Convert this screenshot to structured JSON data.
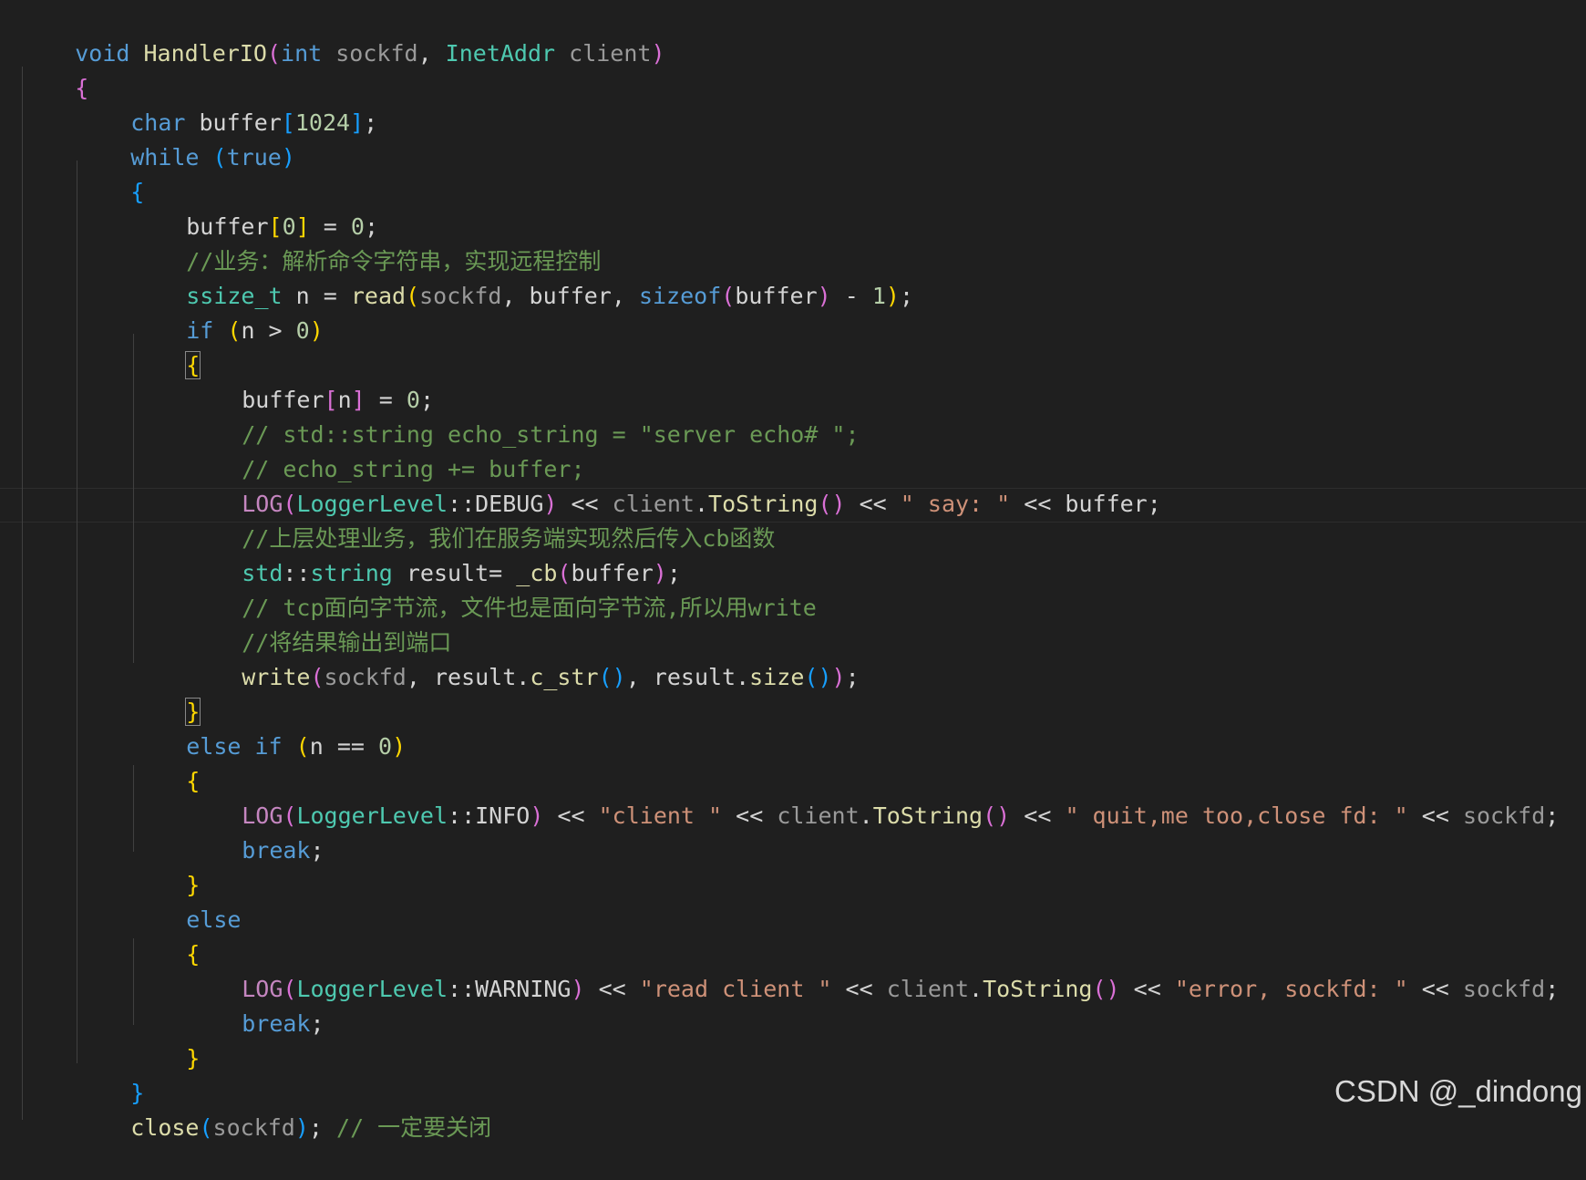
{
  "editor": {
    "line_1": [
      "void",
      " ",
      "HandlerIO",
      "(",
      "int",
      " ",
      "sockfd",
      ", ",
      "InetAddr",
      " ",
      "client",
      ")"
    ],
    "line_2": [
      "{"
    ],
    "line_3": [
      "char",
      " buffer",
      "[",
      "1024",
      "]",
      ";"
    ],
    "line_4": [
      "while",
      " ",
      "(",
      "true",
      ")"
    ],
    "line_5": [
      "{"
    ],
    "line_6": [
      "buffer",
      "[",
      "0",
      "]",
      " = ",
      "0",
      ";"
    ],
    "line_7": [
      "//业务：解析命令字符串，实现远程控制"
    ],
    "line_8": [
      "ssize_t",
      " n = ",
      "read",
      "(",
      "sockfd",
      ", buffer, ",
      "sizeof",
      "(",
      "buffer",
      ")",
      " - ",
      "1",
      ")",
      ";"
    ],
    "line_9": [
      "if",
      " ",
      "(",
      "n > ",
      "0",
      ")"
    ],
    "line_10": [
      "{"
    ],
    "line_11": [
      "buffer",
      "[",
      "n",
      "]",
      " = ",
      "0",
      ";"
    ],
    "line_12": [
      "// std::string echo_string = \"server echo# \";"
    ],
    "line_13": [
      "// echo_string += buffer;"
    ],
    "line_14": [
      "LOG",
      "(",
      "LoggerLevel",
      "::",
      "DEBUG",
      ")",
      " << ",
      "client",
      ".",
      "ToString",
      "()",
      " << ",
      "\" say: \"",
      " << buffer;"
    ],
    "line_15": [
      "//上层处理业务，我们在服务端实现然后传入cb函数"
    ],
    "line_16": [
      "std",
      "::",
      "string",
      " result= ",
      "_cb",
      "(",
      "buffer",
      ")",
      ";"
    ],
    "line_17": [
      "// tcp面向字节流，文件也是面向字节流,所以用write"
    ],
    "line_18": [
      "//将结果输出到端口"
    ],
    "line_19": [
      "write",
      "(",
      "sockfd",
      ", result.",
      "c_str",
      "()",
      ", result.",
      "size",
      "()",
      ")",
      ";"
    ],
    "line_20": [
      "}"
    ],
    "line_21": [
      "else",
      " ",
      "if",
      " ",
      "(",
      "n == ",
      "0",
      ")"
    ],
    "line_22": [
      "{"
    ],
    "line_23": [
      "LOG",
      "(",
      "LoggerLevel",
      "::",
      "INFO",
      ")",
      " << ",
      "\"client \"",
      " << ",
      "client",
      ".",
      "ToString",
      "()",
      " << ",
      "\" quit,me too,close fd: \"",
      " << ",
      "sockfd",
      ";"
    ],
    "line_24": [
      "break",
      ";"
    ],
    "line_25": [
      "}"
    ],
    "line_26": [
      "else"
    ],
    "line_27": [
      "{"
    ],
    "line_28": [
      "LOG",
      "(",
      "LoggerLevel",
      "::",
      "WARNING",
      ")",
      " << ",
      "\"read client \"",
      " << ",
      "client",
      ".",
      "ToString",
      "()",
      " << ",
      "\"error, sockfd: \"",
      " << ",
      "sockfd",
      ";"
    ],
    "line_29": [
      "break",
      ";"
    ],
    "line_30": [
      "}"
    ],
    "line_31": [
      "}"
    ],
    "line_32": [
      "close",
      "(",
      "sockfd",
      ")",
      "; ",
      "// 一定要关闭"
    ]
  },
  "watermark": "CSDN @_dindong",
  "colors": {
    "background": "#1f1f1f",
    "keyword": "#569cd6",
    "type": "#4ec9b0",
    "function": "#dcdcaa",
    "variable": "#9cdcfe",
    "parameter": "#9a9a9a",
    "number": "#b5cea8",
    "string": "#ce9178",
    "comment": "#6a9955",
    "macro": "#c586c0",
    "bracket_level_1": "#ffd700",
    "bracket_level_2": "#da70d6",
    "bracket_level_3": "#179fff"
  }
}
